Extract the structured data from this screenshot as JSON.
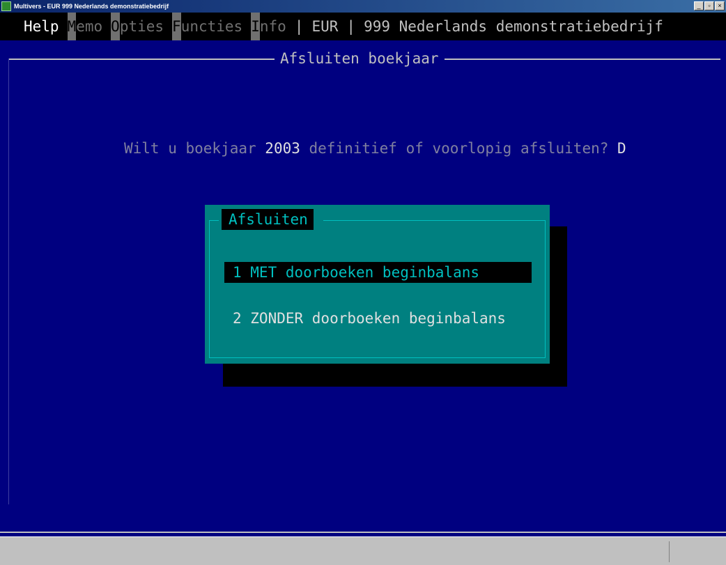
{
  "window": {
    "title": "Multivers - EUR   999 Nederlands demonstratiebedrijf",
    "min_symbol": "_",
    "max_symbol": "▫",
    "close_symbol": "×"
  },
  "menu": {
    "help": "Help",
    "memo_hotkey": "M",
    "memo_rest": "emo",
    "opties_hotkey": "O",
    "opties_rest": "pties",
    "functies_hotkey": "F",
    "functies_rest": "uncties",
    "info_hotkey": "I",
    "info_rest": "nfo",
    "separator": "|",
    "currency": "EUR",
    "company": "999 Nederlands demonstratiebedrijf"
  },
  "frame": {
    "title": "Afsluiten boekjaar"
  },
  "question": {
    "prefix": "Wilt u boekjaar ",
    "year": "2003",
    "suffix": " definitief of voorlopig afsluiten? ",
    "answer": "D"
  },
  "dialog": {
    "title": "Afsluiten",
    "options": [
      "1 MET doorboeken beginbalans",
      "2 ZONDER doorboeken beginbalans"
    ]
  }
}
